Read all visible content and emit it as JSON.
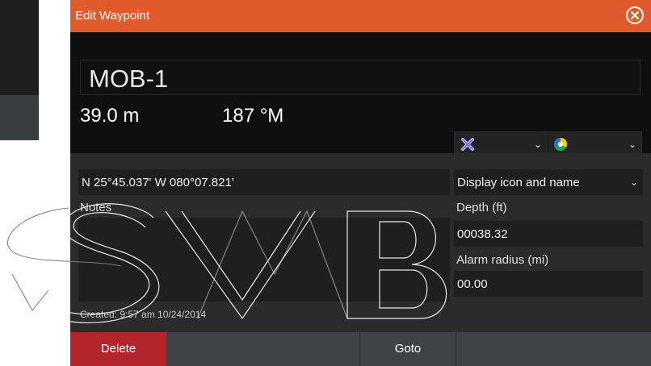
{
  "dialog": {
    "title": "Edit Waypoint",
    "close_icon": "close-circle-icon"
  },
  "waypoint": {
    "name": "MOB-1",
    "distance": "39.0 m",
    "bearing": "187 °M",
    "symbol_icon": "mob-x-icon",
    "color_icon": "color-wheel-icon"
  },
  "details": {
    "position": "N 25°45.037'   W 080°07.821'",
    "display_option": "Display icon and name",
    "notes_label": "Notes",
    "notes_value": "",
    "depth_label": "Depth (ft)",
    "depth_value": "00038.32",
    "alarm_label": "Alarm radius (mi)",
    "alarm_value": "00.00",
    "created": "Created: 9:57 am  10/24/2014"
  },
  "buttons": {
    "delete": "Delete",
    "goto": "Goto"
  },
  "colors": {
    "titlebar": "#e05a2b",
    "delete": "#b3242b",
    "panel": "#2b2b2b"
  }
}
